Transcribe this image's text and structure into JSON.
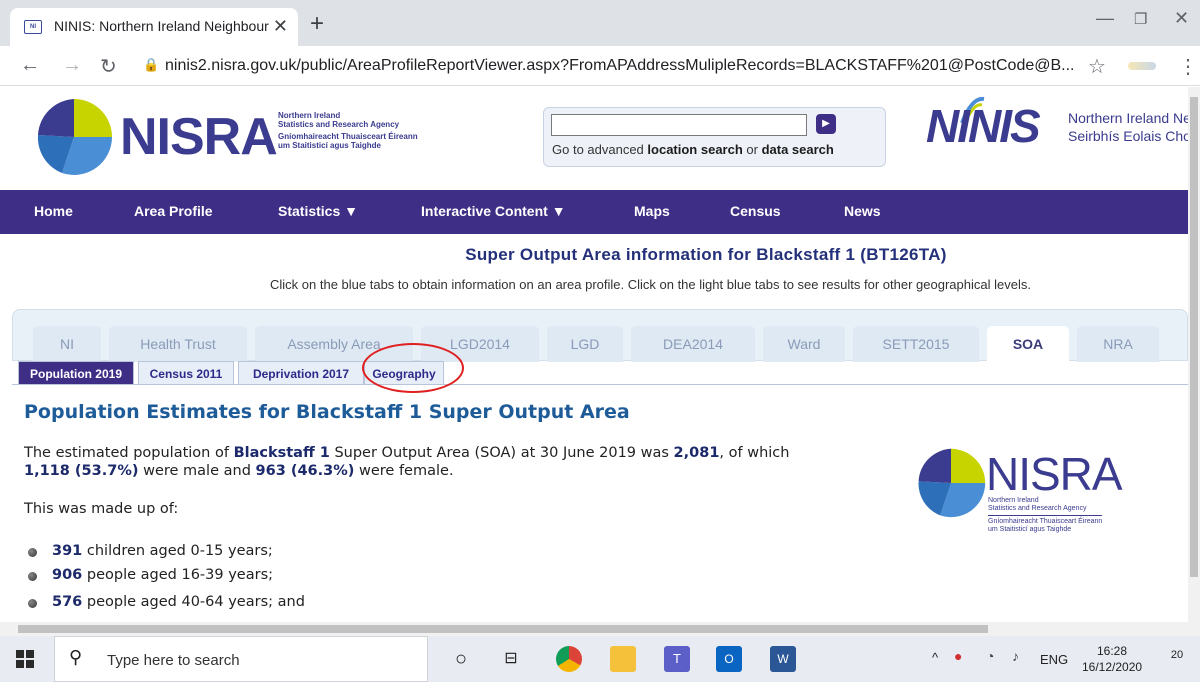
{
  "browser": {
    "tab_title": "NINIS: Northern Ireland Neighbourh",
    "url": "ninis2.nisra.gov.uk/public/AreaProfileReportViewer.aspx?FromAPAddressMulipleRecords=BLACKSTAFF%201@PostCode@B..."
  },
  "header": {
    "nisra_word": "NISRA",
    "agency_lines": [
      "Northern Ireland",
      "Statistics and Research Agency",
      "Gníomhaireacht Thuaisceart Éireann",
      "um Staitisticí agus Taighde"
    ],
    "search_text_prefix": "Go to advanced ",
    "search_link1": "location search",
    "search_or": " or ",
    "search_link2": "data search",
    "ninis_word": "NINIS",
    "ninis_line1": "Northern Ireland Nei",
    "ninis_line2": "Seirbhís Eolais Chor"
  },
  "nav": [
    "Home",
    "Area Profile",
    "Statistics ▼",
    "Interactive Content ▼",
    "Maps",
    "Census",
    "News"
  ],
  "page": {
    "title": "Super Output Area information for Blackstaff 1 (BT126TA)",
    "instructions": "Click on the blue tabs to obtain information on an area profile. Click on the light blue tabs to see results for other geographical levels."
  },
  "geo_tabs": [
    "NI",
    "Health Trust",
    "Assembly Area",
    "LGD2014",
    "LGD",
    "DEA2014",
    "Ward",
    "SETT2015",
    "SOA",
    "NRA"
  ],
  "sub_tabs": [
    "Population 2019",
    "Census 2011",
    "Deprivation 2017",
    "Geography"
  ],
  "content": {
    "heading": "Population Estimates for Blackstaff 1 Super Output Area",
    "p1_a": "The estimated population of ",
    "p1_area": "Blackstaff 1",
    "p1_b": " Super Output Area (SOA) at 30 June 2019 was ",
    "p1_total": "2,081",
    "p1_c": ", of which",
    "p2_male": "1,118 (53.7%)",
    "p2_a": " were male and ",
    "p2_female": "963 (46.3%)",
    "p2_b": " were female.",
    "made_up": "This was made up of:",
    "bullets": [
      {
        "num": "391",
        "text": " children aged 0-15 years;"
      },
      {
        "num": "906",
        "text": " people aged 16-39 years;"
      },
      {
        "num": "576",
        "text": " people aged 40-64 years; and"
      }
    ],
    "logo_word": "NISRA",
    "logo_lines": [
      "Northern Ireland",
      "Statistics and Research Agency",
      "Gníomhaireacht Thuaisceart Éireann",
      "um Staitisticí agus Taighde"
    ]
  },
  "taskbar": {
    "search_placeholder": "Type here to search",
    "lang": "ENG",
    "time": "16:28",
    "date": "16/12/2020",
    "notif_count": "20"
  }
}
